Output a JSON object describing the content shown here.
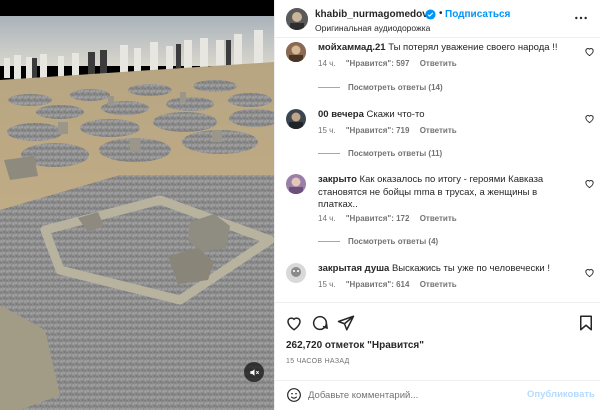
{
  "post": {
    "username": "khabib_nurmagomedov",
    "follow_label": "Подписаться",
    "dot": "•",
    "audio_label": "Оригинальная аудиодорожка"
  },
  "comments": [
    {
      "user": "мойхаммад.21",
      "text": "Ты потерял уважение своего народа !!",
      "time": "14 ч.",
      "likes": "\"Нравится\": 597",
      "reply": "Ответить",
      "replies": "Посмотреть ответы (14)"
    },
    {
      "user": "00 вечера",
      "text": "Скажи что-то",
      "time": "15 ч.",
      "likes": "\"Нравится\": 719",
      "reply": "Ответить",
      "replies": "Посмотреть ответы (11)"
    },
    {
      "user": "закрыто",
      "text": "Как оказалось по итогу - героями Кавказа становятся не бойцы mma в трусах, а женщины в платках..",
      "time": "14 ч.",
      "likes": "\"Нравится\": 172",
      "reply": "Ответить",
      "replies": "Посмотреть ответы (4)"
    },
    {
      "user": "закрытая душа",
      "text": "Выскажись ты уже по человечески !",
      "time": "15 ч.",
      "likes": "\"Нравится\": 614",
      "reply": "Ответить"
    }
  ],
  "actions": {
    "likes": "262,720 отметок \"Нравится\"",
    "time": "15 ЧАСОВ НАЗАД"
  },
  "add_comment": {
    "placeholder": "Добавьте комментарий...",
    "publish_label": "Опубликовать"
  },
  "colors": {
    "accent": "#0095f6",
    "verified": "#0095f6",
    "secondary_text": "#737373"
  },
  "icons": [
    "heart-icon",
    "comment-icon",
    "share-icon",
    "bookmark-icon",
    "more-icon",
    "emoji-icon",
    "verified-icon",
    "mute-icon"
  ]
}
